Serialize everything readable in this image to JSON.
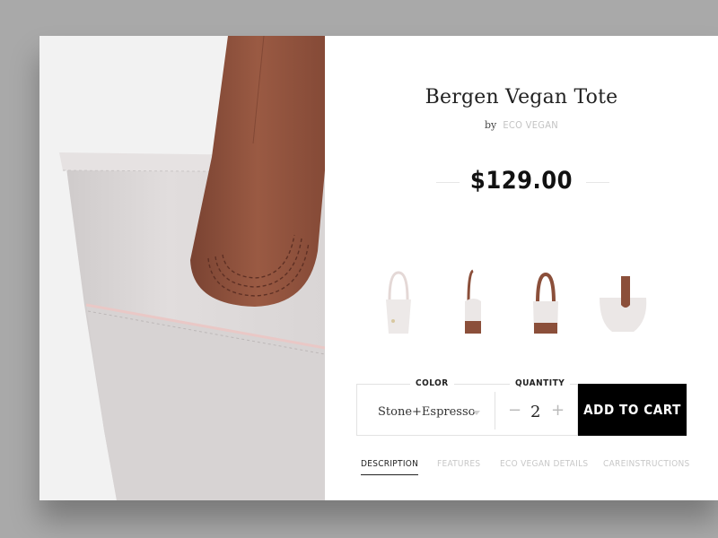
{
  "product": {
    "title": "Bergen Vegan Tote",
    "by_label": "by",
    "brand": "ECO VEGAN",
    "price": "$129.00"
  },
  "thumbnails": [
    {
      "name": "front view"
    },
    {
      "name": "side view"
    },
    {
      "name": "front with brown base"
    },
    {
      "name": "top detail"
    }
  ],
  "options": {
    "color_label": "COLOR",
    "color_value": "Stone+Espresso",
    "quantity_label": "QUANTITY",
    "quantity_value": "2",
    "minus": "−",
    "plus": "+"
  },
  "actions": {
    "add_to_cart": "ADD TO CART"
  },
  "tabs": [
    {
      "label": "DESCRIPTION"
    },
    {
      "label": "FEATURES"
    },
    {
      "label": "ECO VEGAN DETAILS"
    },
    {
      "label": "CAREINSTRUCTIONS"
    }
  ],
  "colors": {
    "leather": "#8b4f3a",
    "canvas": "#dedad9",
    "background": "#a9a9a9",
    "button": "#000000"
  }
}
